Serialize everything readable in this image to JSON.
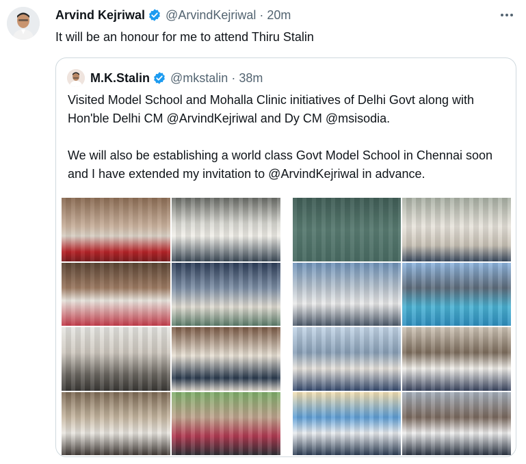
{
  "tweet": {
    "author_name": "Arvind Kejriwal",
    "author_handle": "@ArvindKejriwal",
    "separator": "·",
    "time": "20m",
    "text": "It will be an honour for me to attend Thiru Stalin",
    "more_icon": "ellipsis-icon",
    "verified_icon": "verified-badge-icon"
  },
  "quoted_tweet": {
    "author_name": "M.K.Stalin",
    "author_handle": "@mkstalin",
    "separator": "·",
    "time": "38m",
    "paragraph1": "Visited Model School and Mohalla Clinic initiatives of Delhi Govt along with Hon'ble Delhi CM @ArvindKejriwal and Dy CM @msisodia.",
    "paragraph2": "We will also be establishing a world class Govt Model School in Chennai soon and I have extended my invitation to @ArvindKejriwal in advance.",
    "media_count": 2
  },
  "colors": {
    "text_primary": "#0f1419",
    "text_secondary": "#536471",
    "verified_blue": "#1d9bf0",
    "border": "#cfd9de"
  }
}
